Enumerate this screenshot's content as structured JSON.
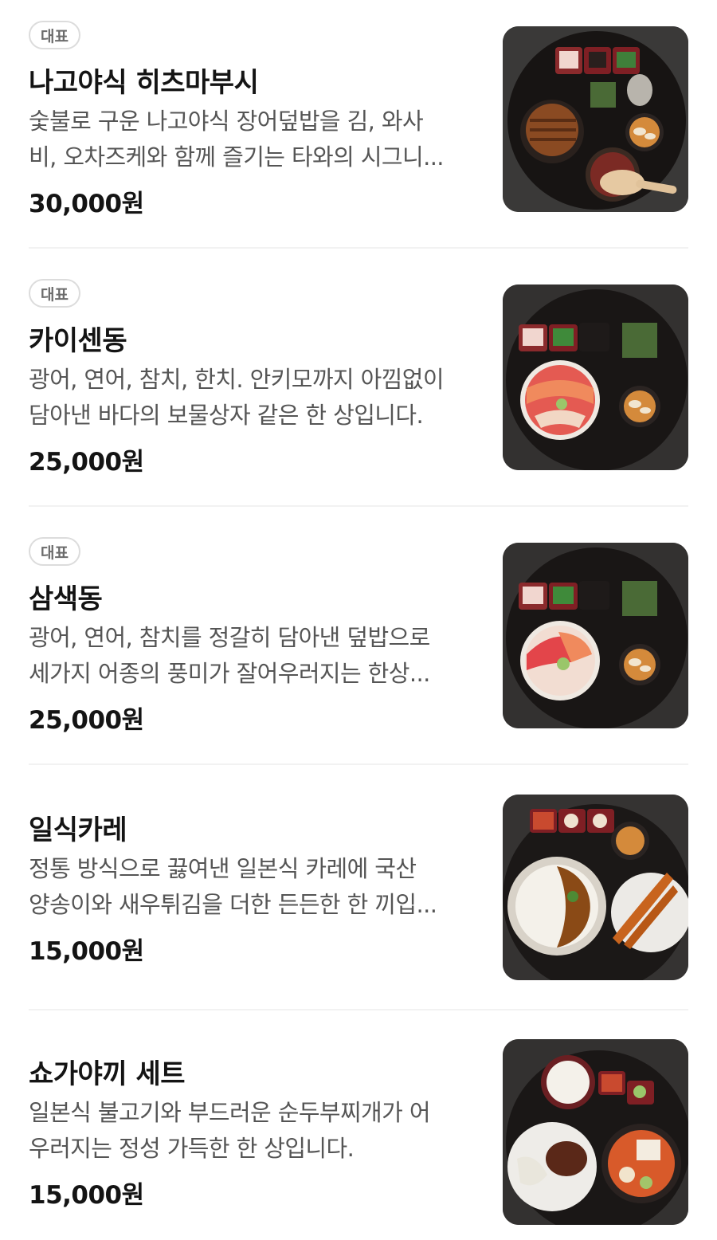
{
  "items": [
    {
      "badge": "대표",
      "name": "나고야식 히츠마부시",
      "desc_line1": "숯불로 구운 나고야식 장어덮밥을 김, 와사",
      "desc_line2": "비, 오차즈케와 함께 즐기는 타와의 시그니...",
      "price": "30,000원",
      "image_icon": "unagi-donburi-image"
    },
    {
      "badge": "대표",
      "name": "카이센동",
      "desc_line1": "광어, 연어, 참치, 한치. 안키모까지 아낌없이",
      "desc_line2": "담아낸 바다의 보물상자 같은 한 상입니다.",
      "price": "25,000원",
      "image_icon": "kaisendon-image"
    },
    {
      "badge": "대표",
      "name": "삼색동",
      "desc_line1": "광어, 연어, 참치를 정갈히 담아낸 덮밥으로",
      "desc_line2": "세가지 어종의 풍미가 잘어우러지는 한상...",
      "price": "25,000원",
      "image_icon": "sashimi-bowl-image"
    },
    {
      "badge": "",
      "name": "일식카레",
      "desc_line1": "정통 방식으로 끓여낸 일본식 카레에 국산",
      "desc_line2": "양송이와 새우튀김을 더한 든든한 한 끼입...",
      "price": "15,000원",
      "image_icon": "curry-image"
    },
    {
      "badge": "",
      "name": "쇼가야끼 세트",
      "desc_line1": "일본식 불고기와 부드러운 순두부찌개가 어",
      "desc_line2": "우러지는 정성 가득한 한 상입니다.",
      "price": "15,000원",
      "image_icon": "shogayaki-set-image"
    }
  ]
}
